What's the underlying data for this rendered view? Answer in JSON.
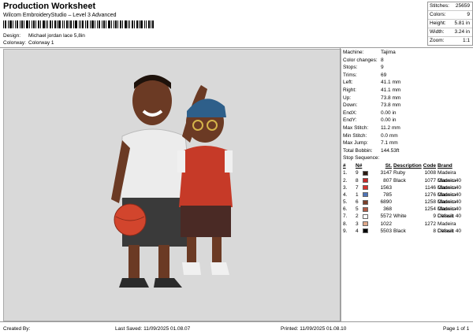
{
  "header": {
    "title": "Production Worksheet",
    "subtitle": "Wilcom EmbroideryStudio – Level 3 Advanced",
    "design_label": "Design:",
    "design_value": "Michael jordan lace 5,8in",
    "colorway_label": "Colorway:",
    "colorway_value": "Colorway 1"
  },
  "summary": [
    {
      "k": "Stitches:",
      "v": "25659"
    },
    {
      "k": "Colors:",
      "v": "9"
    },
    {
      "k": "Height:",
      "v": "5.81 in"
    },
    {
      "k": "Width:",
      "v": "3.24 in"
    },
    {
      "k": "Zoom:",
      "v": "1:1"
    }
  ],
  "machine_info": [
    {
      "k": "Machine:",
      "v": "Tajima"
    },
    {
      "k": "Color changes:",
      "v": "8"
    },
    {
      "k": "Stops:",
      "v": "9"
    },
    {
      "k": "Trims:",
      "v": "69"
    },
    {
      "k": "Left:",
      "v": "41.1 mm"
    },
    {
      "k": "Right:",
      "v": "41.1 mm"
    },
    {
      "k": "Up:",
      "v": "73.8 mm"
    },
    {
      "k": "Down:",
      "v": "73.8 mm"
    },
    {
      "k": "EndX:",
      "v": "0.00 in"
    },
    {
      "k": "EndY:",
      "v": "0.00 in"
    },
    {
      "k": "Max Stitch:",
      "v": "11.2 mm"
    },
    {
      "k": "Min Stitch:",
      "v": "0.0 mm"
    },
    {
      "k": "Max Jump:",
      "v": "7.1 mm"
    },
    {
      "k": "Total Bobbin:",
      "v": "144.53ft"
    }
  ],
  "stop_sequence_label": "Stop Sequence:",
  "stop_columns": {
    "num": "#",
    "n": "N#",
    "st": "St.",
    "desc": "Description",
    "code": "Code",
    "brand": "Brand"
  },
  "stops": [
    {
      "num": "1.",
      "n": "9",
      "color": "#2b1b12",
      "st": "3147",
      "desc": "Ruby Black",
      "code": "1008",
      "brand": "Madeira Classic 40"
    },
    {
      "num": "2.",
      "n": "8",
      "color": "#c62828",
      "st": "807",
      "desc": "",
      "code": "1077",
      "brand": "Madeira Classic 40"
    },
    {
      "num": "3.",
      "n": "7",
      "color": "#d8322c",
      "st": "1563",
      "desc": "",
      "code": "1146",
      "brand": "Madeira Classic 40"
    },
    {
      "num": "4.",
      "n": "1",
      "color": "#4f74b8",
      "st": "785",
      "desc": "",
      "code": "1276",
      "brand": "Madeira Classic 40"
    },
    {
      "num": "5.",
      "n": "6",
      "color": "#7a3f2a",
      "st": "6890",
      "desc": "",
      "code": "1258",
      "brand": "Madeira Classic 40"
    },
    {
      "num": "6.",
      "n": "5",
      "color": "#b05a45",
      "st": "368",
      "desc": "",
      "code": "1254",
      "brand": "Madeira Classic 40"
    },
    {
      "num": "7.",
      "n": "2",
      "color": "#ffffff",
      "st": "5572",
      "desc": "White",
      "code": "9",
      "brand": "Default"
    },
    {
      "num": "8.",
      "n": "3",
      "color": "#e0a98a",
      "st": "1022",
      "desc": "",
      "code": "1272",
      "brand": "Madeira Classic 40"
    },
    {
      "num": "9.",
      "n": "4",
      "color": "#000000",
      "st": "5503",
      "desc": "Black",
      "code": "8",
      "brand": "Default"
    }
  ],
  "footer": {
    "created_by": "Created By:",
    "last_saved": "Last Saved: 11/09/2025 01.08.07",
    "printed": "Printed: 11/09/2025 01.08.10",
    "page": "Page 1 of 1"
  }
}
